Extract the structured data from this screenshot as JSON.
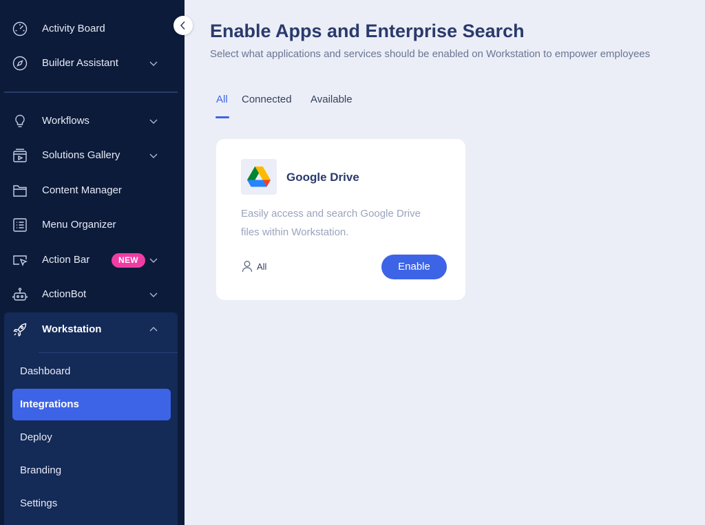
{
  "sidebar": {
    "top_items": [
      {
        "label": "Activity Board",
        "icon": "gauge-icon"
      },
      {
        "label": "Builder Assistant",
        "icon": "compass-icon"
      }
    ],
    "items": [
      {
        "label": "Workflows",
        "icon": "lightbulb-icon"
      },
      {
        "label": "Solutions Gallery",
        "icon": "gallery-box-icon"
      },
      {
        "label": "Content Manager",
        "icon": "folder-icon"
      },
      {
        "label": "Menu Organizer",
        "icon": "list-icon"
      },
      {
        "label": "Action Bar",
        "icon": "cursor-window-icon",
        "badge": "NEW"
      },
      {
        "label": "ActionBot",
        "icon": "robot-icon"
      }
    ],
    "workstation": {
      "label": "Workstation",
      "icon": "rocket-icon",
      "sub_items": [
        {
          "label": "Dashboard"
        },
        {
          "label": "Integrations",
          "active": true
        },
        {
          "label": "Deploy"
        },
        {
          "label": "Branding"
        },
        {
          "label": "Settings"
        }
      ]
    }
  },
  "header": {
    "title": "Enable Apps and Enterprise Search",
    "subtitle": "Select what applications and services should be enabled on Workstation to empower employees"
  },
  "tabs": [
    {
      "label": "All",
      "active": true
    },
    {
      "label": "Connected"
    },
    {
      "label": "Available"
    }
  ],
  "cards": [
    {
      "title": "Google Drive",
      "logo": "google-drive-logo",
      "description": "Easily access and search Google Drive files within Workstation.",
      "audience": "All",
      "action_label": "Enable"
    }
  ],
  "colors": {
    "sidebar_bg": "#0c1b3a",
    "accent": "#3d64e6",
    "badge": "#ef3da4",
    "page_bg": "#ebeef7"
  }
}
